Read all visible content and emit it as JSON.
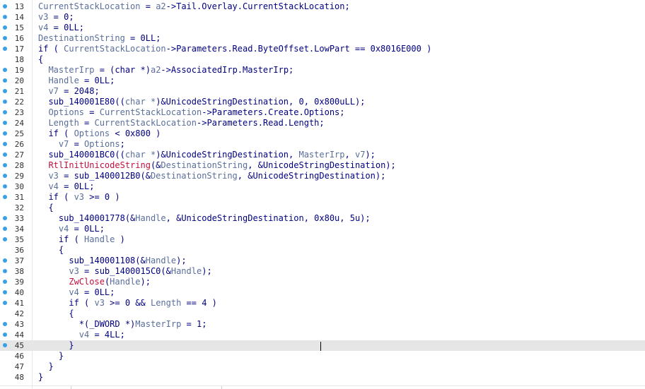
{
  "editor": {
    "current_line": "45",
    "lines": [
      {
        "num": "13",
        "bp": true,
        "indent": "",
        "tokens": [
          {
            "t": "CurrentStackLocation",
            "c": "v"
          },
          {
            "t": " = ",
            "c": "d"
          },
          {
            "t": "a2",
            "c": "v"
          },
          {
            "t": "->Tail.Overlay.CurrentStackLocation;",
            "c": "d"
          }
        ]
      },
      {
        "num": "14",
        "bp": true,
        "indent": "",
        "tokens": [
          {
            "t": "v3",
            "c": "v"
          },
          {
            "t": " = 0;",
            "c": "d"
          }
        ]
      },
      {
        "num": "15",
        "bp": true,
        "indent": "",
        "tokens": [
          {
            "t": "v4",
            "c": "v"
          },
          {
            "t": " = 0LL;",
            "c": "d"
          }
        ]
      },
      {
        "num": "16",
        "bp": true,
        "indent": "",
        "tokens": [
          {
            "t": "DestinationString",
            "c": "v"
          },
          {
            "t": " = 0LL;",
            "c": "d"
          }
        ]
      },
      {
        "num": "17",
        "bp": true,
        "indent": "",
        "tokens": [
          {
            "t": "if ( ",
            "c": "d"
          },
          {
            "t": "CurrentStackLocation",
            "c": "v"
          },
          {
            "t": "->Parameters.Read.ByteOffset.LowPart == 0x8016E000 )",
            "c": "d"
          }
        ]
      },
      {
        "num": "18",
        "bp": false,
        "indent": "",
        "tokens": [
          {
            "t": "{",
            "c": "d"
          }
        ]
      },
      {
        "num": "19",
        "bp": true,
        "indent": "  ",
        "tokens": [
          {
            "t": "MasterIrp",
            "c": "v"
          },
          {
            "t": " = (char *)",
            "c": "d"
          },
          {
            "t": "a2",
            "c": "v"
          },
          {
            "t": "->AssociatedIrp.MasterIrp;",
            "c": "d"
          }
        ]
      },
      {
        "num": "20",
        "bp": true,
        "indent": "  ",
        "tokens": [
          {
            "t": "Handle",
            "c": "v"
          },
          {
            "t": " = 0LL;",
            "c": "d"
          }
        ]
      },
      {
        "num": "21",
        "bp": true,
        "indent": "  ",
        "tokens": [
          {
            "t": "v7",
            "c": "v"
          },
          {
            "t": " = 2048;",
            "c": "d"
          }
        ]
      },
      {
        "num": "22",
        "bp": true,
        "indent": "  ",
        "tokens": [
          {
            "t": "sub_140001E80((",
            "c": "d"
          },
          {
            "t": "char *",
            "c": "v"
          },
          {
            "t": ")&UnicodeStringDestination, 0, 0x800uLL);",
            "c": "d"
          }
        ]
      },
      {
        "num": "23",
        "bp": true,
        "indent": "  ",
        "tokens": [
          {
            "t": "Options",
            "c": "v"
          },
          {
            "t": " = ",
            "c": "d"
          },
          {
            "t": "CurrentStackLocation",
            "c": "v"
          },
          {
            "t": "->Parameters.Create.Options;",
            "c": "d"
          }
        ]
      },
      {
        "num": "24",
        "bp": true,
        "indent": "  ",
        "tokens": [
          {
            "t": "Length",
            "c": "v"
          },
          {
            "t": " = ",
            "c": "d"
          },
          {
            "t": "CurrentStackLocation",
            "c": "v"
          },
          {
            "t": "->Parameters.Read.Length;",
            "c": "d"
          }
        ]
      },
      {
        "num": "25",
        "bp": true,
        "indent": "  ",
        "tokens": [
          {
            "t": "if ( ",
            "c": "d"
          },
          {
            "t": "Options",
            "c": "v"
          },
          {
            "t": " < 0x800 )",
            "c": "d"
          }
        ]
      },
      {
        "num": "26",
        "bp": true,
        "indent": "    ",
        "tokens": [
          {
            "t": "v7",
            "c": "v"
          },
          {
            "t": " = ",
            "c": "d"
          },
          {
            "t": "Options",
            "c": "v"
          },
          {
            "t": ";",
            "c": "d"
          }
        ]
      },
      {
        "num": "27",
        "bp": true,
        "indent": "  ",
        "tokens": [
          {
            "t": "sub_140001BC0((",
            "c": "d"
          },
          {
            "t": "char *",
            "c": "v"
          },
          {
            "t": ")&UnicodeStringDestination, ",
            "c": "d"
          },
          {
            "t": "MasterIrp",
            "c": "v"
          },
          {
            "t": ", ",
            "c": "d"
          },
          {
            "t": "v7",
            "c": "v"
          },
          {
            "t": ");",
            "c": "d"
          }
        ]
      },
      {
        "num": "28",
        "bp": true,
        "indent": "  ",
        "tokens": [
          {
            "t": "RtlInitUnicodeString",
            "c": "f"
          },
          {
            "t": "(&",
            "c": "d"
          },
          {
            "t": "DestinationString",
            "c": "v"
          },
          {
            "t": ", &UnicodeStringDestination);",
            "c": "d"
          }
        ]
      },
      {
        "num": "29",
        "bp": true,
        "indent": "  ",
        "tokens": [
          {
            "t": "v3",
            "c": "v"
          },
          {
            "t": " = sub_1400012B0(&",
            "c": "d"
          },
          {
            "t": "DestinationString",
            "c": "v"
          },
          {
            "t": ", &UnicodeStringDestination);",
            "c": "d"
          }
        ]
      },
      {
        "num": "30",
        "bp": true,
        "indent": "  ",
        "tokens": [
          {
            "t": "v4",
            "c": "v"
          },
          {
            "t": " = 0LL;",
            "c": "d"
          }
        ]
      },
      {
        "num": "31",
        "bp": true,
        "indent": "  ",
        "tokens": [
          {
            "t": "if ( ",
            "c": "d"
          },
          {
            "t": "v3",
            "c": "v"
          },
          {
            "t": " >= 0 )",
            "c": "d"
          }
        ]
      },
      {
        "num": "32",
        "bp": false,
        "indent": "  ",
        "tokens": [
          {
            "t": "{",
            "c": "d"
          }
        ]
      },
      {
        "num": "33",
        "bp": true,
        "indent": "    ",
        "tokens": [
          {
            "t": "sub_140001778(&",
            "c": "d"
          },
          {
            "t": "Handle",
            "c": "v"
          },
          {
            "t": ", &UnicodeStringDestination, 0x80u, 5u);",
            "c": "d"
          }
        ]
      },
      {
        "num": "34",
        "bp": true,
        "indent": "    ",
        "tokens": [
          {
            "t": "v4",
            "c": "v"
          },
          {
            "t": " = 0LL;",
            "c": "d"
          }
        ]
      },
      {
        "num": "35",
        "bp": true,
        "indent": "    ",
        "tokens": [
          {
            "t": "if ( ",
            "c": "d"
          },
          {
            "t": "Handle",
            "c": "v"
          },
          {
            "t": " )",
            "c": "d"
          }
        ]
      },
      {
        "num": "36",
        "bp": false,
        "indent": "    ",
        "tokens": [
          {
            "t": "{",
            "c": "d"
          }
        ]
      },
      {
        "num": "37",
        "bp": true,
        "indent": "      ",
        "tokens": [
          {
            "t": "sub_140001108(&",
            "c": "d"
          },
          {
            "t": "Handle",
            "c": "v"
          },
          {
            "t": ");",
            "c": "d"
          }
        ]
      },
      {
        "num": "38",
        "bp": true,
        "indent": "      ",
        "tokens": [
          {
            "t": "v3",
            "c": "v"
          },
          {
            "t": " = sub_1400015C0(&",
            "c": "d"
          },
          {
            "t": "Handle",
            "c": "v"
          },
          {
            "t": ");",
            "c": "d"
          }
        ]
      },
      {
        "num": "39",
        "bp": true,
        "indent": "      ",
        "tokens": [
          {
            "t": "ZwClose",
            "c": "f"
          },
          {
            "t": "(",
            "c": "d"
          },
          {
            "t": "Handle",
            "c": "v"
          },
          {
            "t": ");",
            "c": "d"
          }
        ]
      },
      {
        "num": "40",
        "bp": true,
        "indent": "      ",
        "tokens": [
          {
            "t": "v4",
            "c": "v"
          },
          {
            "t": " = 0LL;",
            "c": "d"
          }
        ]
      },
      {
        "num": "41",
        "bp": true,
        "indent": "      ",
        "tokens": [
          {
            "t": "if ( ",
            "c": "d"
          },
          {
            "t": "v3",
            "c": "v"
          },
          {
            "t": " >= 0 && ",
            "c": "d"
          },
          {
            "t": "Length",
            "c": "v"
          },
          {
            "t": " == 4 )",
            "c": "d"
          }
        ]
      },
      {
        "num": "42",
        "bp": false,
        "indent": "      ",
        "tokens": [
          {
            "t": "{",
            "c": "d"
          }
        ]
      },
      {
        "num": "43",
        "bp": true,
        "indent": "        ",
        "tokens": [
          {
            "t": "*(_DWORD *)",
            "c": "d"
          },
          {
            "t": "MasterIrp",
            "c": "v"
          },
          {
            "t": " = 1;",
            "c": "d"
          }
        ]
      },
      {
        "num": "44",
        "bp": true,
        "indent": "        ",
        "tokens": [
          {
            "t": "v4",
            "c": "v"
          },
          {
            "t": " = 4LL;",
            "c": "d"
          }
        ]
      },
      {
        "num": "45",
        "bp": true,
        "indent": "      ",
        "tokens": [
          {
            "t": "}",
            "c": "d"
          }
        ]
      },
      {
        "num": "46",
        "bp": false,
        "indent": "    ",
        "tokens": [
          {
            "t": "}",
            "c": "d"
          }
        ]
      },
      {
        "num": "47",
        "bp": false,
        "indent": "  ",
        "tokens": [
          {
            "t": "}",
            "c": "d"
          }
        ]
      },
      {
        "num": "48",
        "bp": false,
        "indent": "",
        "tokens": [
          {
            "t": "}",
            "c": "d"
          }
        ]
      }
    ]
  },
  "colors": {
    "default": "#000080",
    "variable": "#5a6e9a",
    "function": "#c01040",
    "breakpoint": "#3aa0e6",
    "current_line_bg": "#e6e6e6"
  }
}
